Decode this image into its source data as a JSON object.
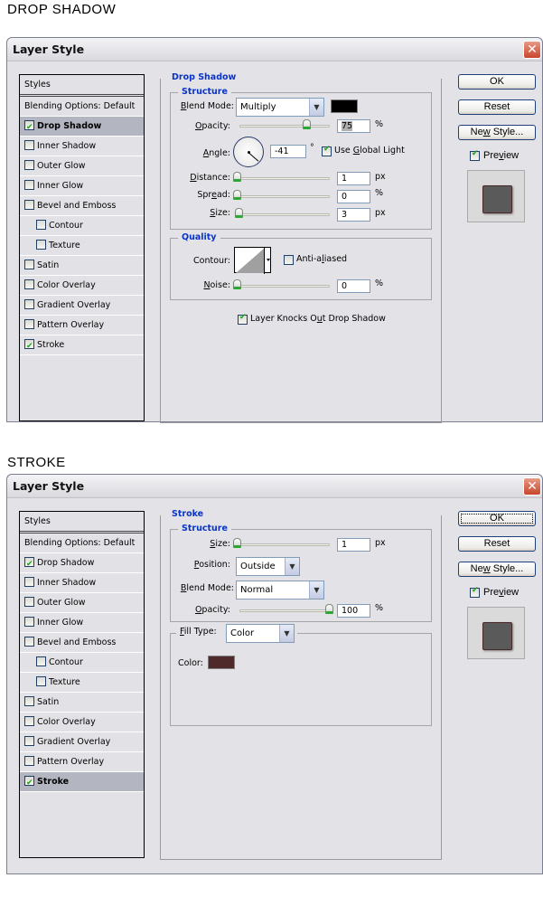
{
  "screens": [
    {
      "section_title": "DROP SHADOW",
      "dialog_title": "Layer Style",
      "styles_header": "Styles",
      "blending_options": "Blending Options: Default",
      "style_items": [
        {
          "label": "Drop Shadow",
          "checked": true,
          "selected": true,
          "sub": false
        },
        {
          "label": "Inner Shadow",
          "checked": false,
          "selected": false,
          "sub": false
        },
        {
          "label": "Outer Glow",
          "checked": false,
          "selected": false,
          "sub": false
        },
        {
          "label": "Inner Glow",
          "checked": false,
          "selected": false,
          "sub": false
        },
        {
          "label": "Bevel and Emboss",
          "checked": false,
          "selected": false,
          "sub": false
        },
        {
          "label": "Contour",
          "checked": false,
          "selected": false,
          "sub": true
        },
        {
          "label": "Texture",
          "checked": false,
          "selected": false,
          "sub": true
        },
        {
          "label": "Satin",
          "checked": false,
          "selected": false,
          "sub": false
        },
        {
          "label": "Color Overlay",
          "checked": false,
          "selected": false,
          "sub": false
        },
        {
          "label": "Gradient Overlay",
          "checked": false,
          "selected": false,
          "sub": false
        },
        {
          "label": "Pattern Overlay",
          "checked": false,
          "selected": false,
          "sub": false
        },
        {
          "label": "Stroke",
          "checked": true,
          "selected": false,
          "sub": false
        }
      ],
      "panel_title": "Drop Shadow",
      "structure_title": "Structure",
      "blend_mode_label": "Blend Mode:",
      "blend_mode_value": "Multiply",
      "shadow_color": "#000000",
      "opacity_label": "Opacity:",
      "opacity_value": "75",
      "opacity_fraction": 0.75,
      "percent": "%",
      "angle_label": "Angle:",
      "angle_value": "-41",
      "degree": "°",
      "use_global_light": "Use Global Light",
      "use_global_light_checked": true,
      "distance_label": "Distance:",
      "distance_value": "1",
      "spread_label": "Spread:",
      "spread_value": "0",
      "size_label": "Size:",
      "size_value": "3",
      "px": "px",
      "quality_title": "Quality",
      "contour_label": "Contour:",
      "anti_aliased": "Anti-aliased",
      "anti_aliased_checked": false,
      "noise_label": "Noise:",
      "noise_value": "0",
      "knocks_out": "Layer Knocks Out Drop Shadow",
      "knocks_out_checked": true,
      "ok": "OK",
      "reset": "Reset",
      "new_style": "New Style...",
      "preview": "Preview",
      "preview_checked": true
    },
    {
      "section_title": "STROKE",
      "dialog_title": "Layer Style",
      "styles_header": "Styles",
      "blending_options": "Blending Options: Default",
      "style_items": [
        {
          "label": "Drop Shadow",
          "checked": true,
          "selected": false,
          "sub": false
        },
        {
          "label": "Inner Shadow",
          "checked": false,
          "selected": false,
          "sub": false
        },
        {
          "label": "Outer Glow",
          "checked": false,
          "selected": false,
          "sub": false
        },
        {
          "label": "Inner Glow",
          "checked": false,
          "selected": false,
          "sub": false
        },
        {
          "label": "Bevel and Emboss",
          "checked": false,
          "selected": false,
          "sub": false
        },
        {
          "label": "Contour",
          "checked": false,
          "selected": false,
          "sub": true
        },
        {
          "label": "Texture",
          "checked": false,
          "selected": false,
          "sub": true
        },
        {
          "label": "Satin",
          "checked": false,
          "selected": false,
          "sub": false
        },
        {
          "label": "Color Overlay",
          "checked": false,
          "selected": false,
          "sub": false
        },
        {
          "label": "Gradient Overlay",
          "checked": false,
          "selected": false,
          "sub": false
        },
        {
          "label": "Pattern Overlay",
          "checked": false,
          "selected": false,
          "sub": false
        },
        {
          "label": "Stroke",
          "checked": true,
          "selected": true,
          "sub": false
        }
      ],
      "panel_title": "Stroke",
      "structure_title": "Structure",
      "size_label": "Size:",
      "size_value": "1",
      "px": "px",
      "position_label": "Position:",
      "position_value": "Outside",
      "blend_mode_label": "Blend Mode:",
      "blend_mode_value": "Normal",
      "opacity_label": "Opacity:",
      "opacity_value": "100",
      "opacity_fraction": 1.0,
      "percent": "%",
      "fill_type_label": "Fill Type:",
      "fill_type_value": "Color",
      "color_label": "Color:",
      "stroke_color": "#4e2a2a",
      "ok": "OK",
      "reset": "Reset",
      "new_style": "New Style...",
      "preview": "Preview",
      "preview_checked": true
    }
  ]
}
